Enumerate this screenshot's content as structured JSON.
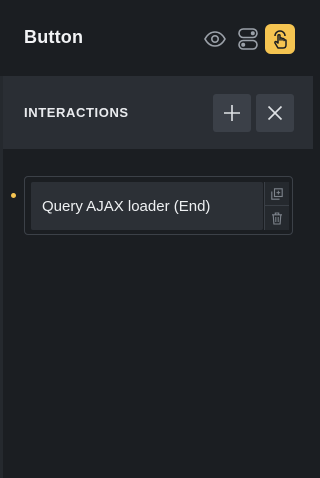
{
  "header": {
    "title": "Button",
    "icons": [
      "eye-icon",
      "toggle-icon",
      "interaction-hand-icon"
    ]
  },
  "section": {
    "title": "INTERACTIONS",
    "add_icon": "plus-icon",
    "close_icon": "close-icon"
  },
  "interactions": [
    {
      "label": "Query AJAX loader (End)",
      "actions": [
        "duplicate-icon",
        "trash-icon"
      ]
    }
  ],
  "colors": {
    "background": "#1b1e22",
    "section_bg": "#2a2e34",
    "button_bg": "#3b4048",
    "accent": "#f5c451"
  }
}
